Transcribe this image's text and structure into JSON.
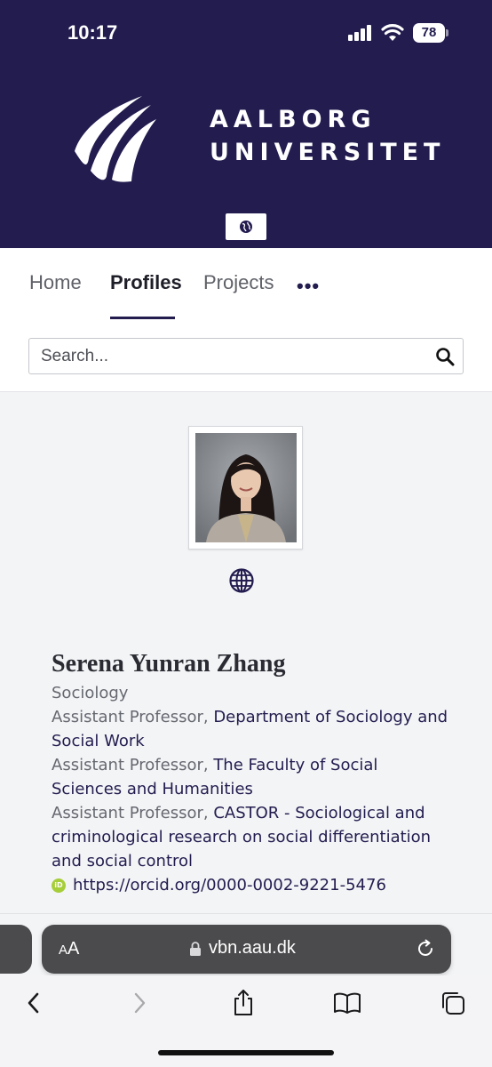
{
  "status": {
    "time": "10:17",
    "battery": "78"
  },
  "brand": {
    "line1": "AALBORG",
    "line2": "UNIVERSITET",
    "color": "#221c4f"
  },
  "nav": {
    "items": [
      {
        "label": "Home"
      },
      {
        "label": "Profiles"
      },
      {
        "label": "Projects"
      }
    ],
    "more_label": "•••",
    "active_index": 1
  },
  "search": {
    "placeholder": "Search..."
  },
  "profile": {
    "name": "Serena Yunran Zhang",
    "department": "Sociology",
    "positions": [
      {
        "title": "Assistant Professor, ",
        "org": "Department of Sociology and Social Work"
      },
      {
        "title": "Assistant Professor, ",
        "org": "The Faculty of Social Sciences and Humanities"
      },
      {
        "title": "Assistant Professor, ",
        "org": "CASTOR - Sociological and criminological research on social differentiation and social control"
      }
    ],
    "orcid_badge": "iD",
    "orcid": "https://orcid.org/0000-0002-9221-5476"
  },
  "browser": {
    "aa_small": "A",
    "aa_large": "A",
    "url": "vbn.aau.dk"
  },
  "icons": [
    "globe-icon",
    "search-icon",
    "lock-icon",
    "reload-icon",
    "back-icon",
    "forward-icon",
    "share-icon",
    "bookmarks-icon",
    "tabs-icon"
  ]
}
